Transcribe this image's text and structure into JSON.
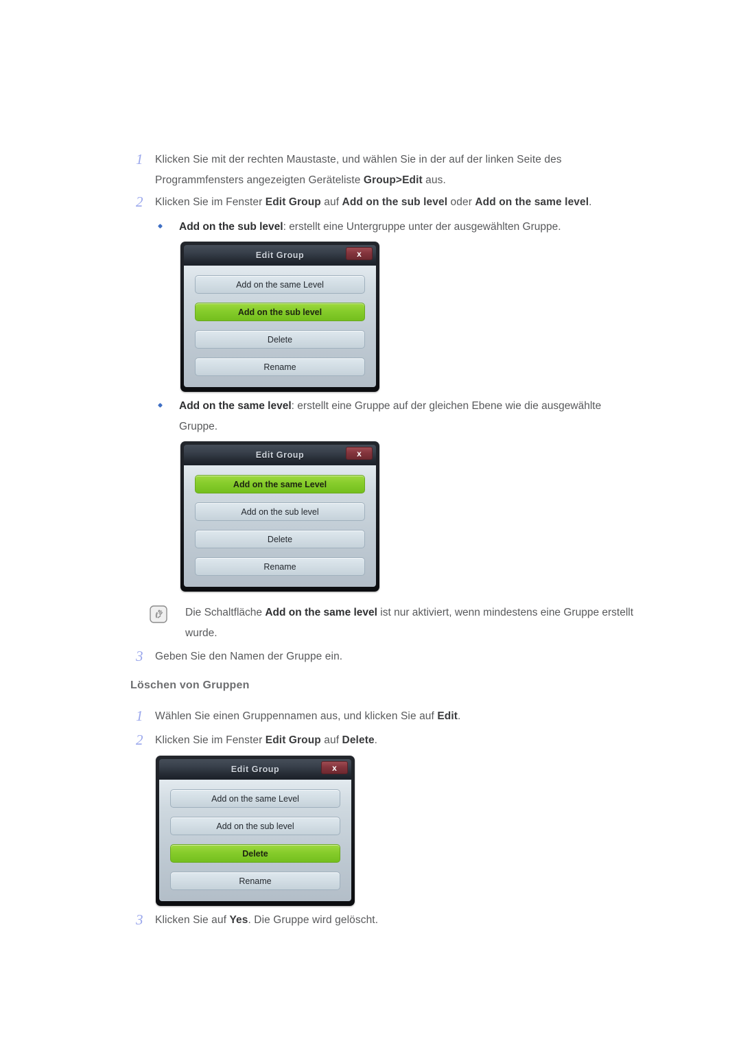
{
  "steps": {
    "s1": {
      "num": "1",
      "line1_a": "Klicken Sie mit der rechten Maustaste, und wählen Sie in der auf der linken Seite des",
      "line2_a": "Programmfensters angezeigten Geräteliste ",
      "line2_b": "Group>Edit",
      "line2_c": " aus."
    },
    "s2": {
      "num": "2",
      "a": "Klicken Sie im Fenster ",
      "b": "Edit Group",
      "c": " auf ",
      "d": "Add on the sub level",
      "e": " oder ",
      "f": "Add on the same level",
      "g": "."
    },
    "s3": {
      "num": "3",
      "text": "Geben Sie den Namen der Gruppe ein."
    },
    "d1": {
      "num": "1",
      "a": "Wählen Sie einen Gruppennamen aus, und klicken Sie auf ",
      "b": "Edit",
      "c": "."
    },
    "d2": {
      "num": "2",
      "a": "Klicken Sie im Fenster ",
      "b": "Edit Group",
      "c": " auf ",
      "d": "Delete",
      "e": "."
    },
    "d3": {
      "num": "3",
      "a": "Klicken Sie auf ",
      "b": "Yes",
      "c": ". Die Gruppe wird gelöscht."
    }
  },
  "bullets": {
    "b1": {
      "bold": "Add on the sub level",
      "rest": ": erstellt eine Untergruppe unter der ausgewählten Gruppe."
    },
    "b2": {
      "bold": "Add on the same level",
      "rest": ": erstellt eine Gruppe auf der gleichen Ebene wie die ausgewählte",
      "line2": "Gruppe."
    }
  },
  "note": {
    "icon": "note-pencil-icon",
    "a": "Die Schaltfläche ",
    "b": "Add on the same level",
    "c": " ist nur aktiviert, wenn mindestens eine Gruppe erstellt",
    "line2": "wurde."
  },
  "heading": {
    "loeschen": "Löschen von Gruppen"
  },
  "dialogs": {
    "title": "Edit Group",
    "close_label": "x",
    "buttons": {
      "same_level": "Add on the same Level",
      "sub_level": "Add on the sub level",
      "delete": "Delete",
      "rename": "Rename"
    },
    "d1_highlight": "Add on the sub level",
    "d2_highlight": "Add on the same Level",
    "d3_highlight": "Delete"
  },
  "colors": {
    "step_number": "#9aa7ec",
    "bullet": "#3f6fc4",
    "highlight_green": "#86cc2b",
    "close_red": "#84353d",
    "titlebar_dark": "#39414c",
    "body_text": "#58595b"
  }
}
